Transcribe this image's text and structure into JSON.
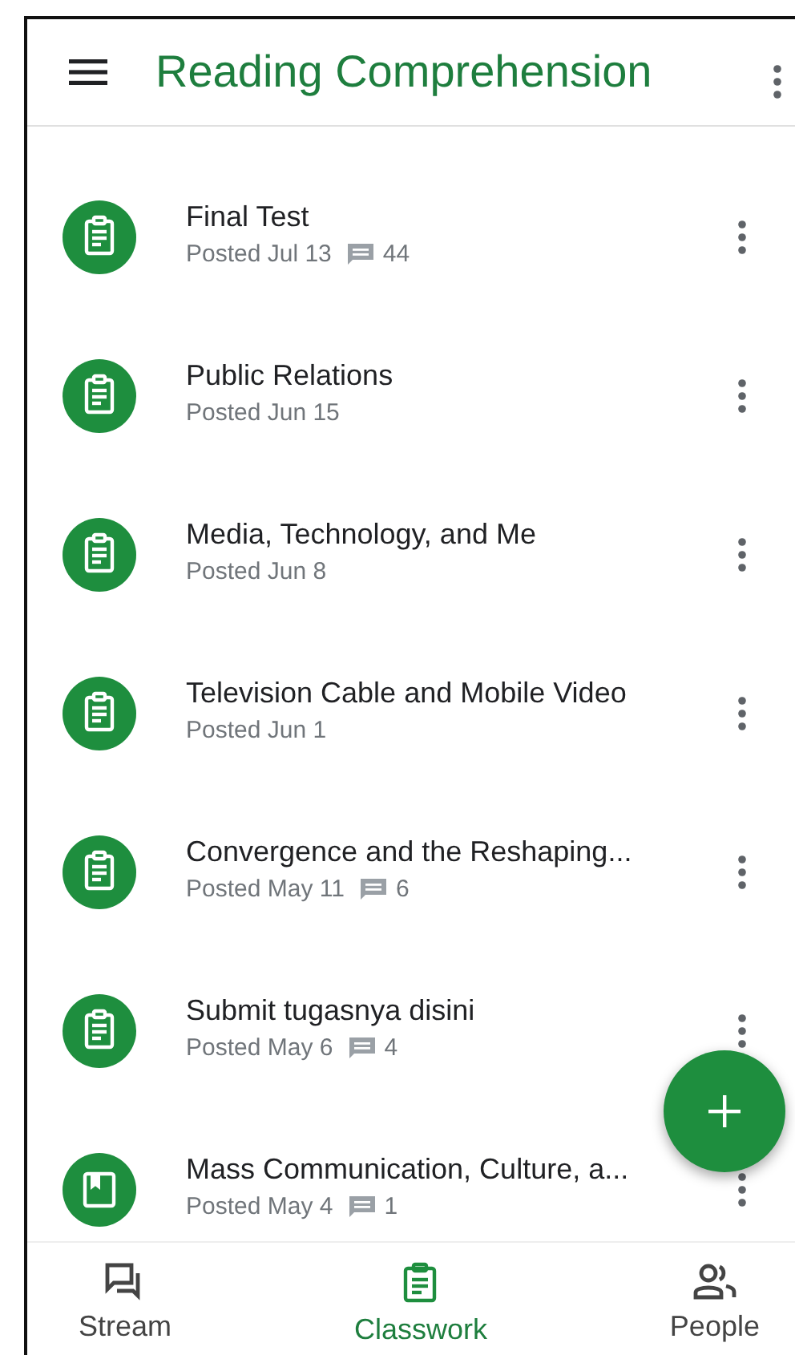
{
  "app_bar": {
    "title": "Reading Comprehension"
  },
  "items": [
    {
      "kind": "assignment",
      "title": "Final Test",
      "posted": "Posted Jul 13",
      "comments": "44"
    },
    {
      "kind": "assignment",
      "title": "Public Relations",
      "posted": "Posted Jun 15"
    },
    {
      "kind": "assignment",
      "title": "Media, Technology, and Me",
      "posted": "Posted Jun 8"
    },
    {
      "kind": "assignment",
      "title": "Television Cable and Mobile Video",
      "posted": "Posted Jun 1"
    },
    {
      "kind": "assignment",
      "title": "Convergence and the Reshaping...",
      "posted": "Posted May 11",
      "comments": "6"
    },
    {
      "kind": "assignment",
      "title": "Submit tugasnya disini",
      "posted": "Posted May 6",
      "comments": "4"
    },
    {
      "kind": "material",
      "title": "Mass Communication, Culture, a...",
      "posted": "Posted May 4",
      "comments": "1"
    }
  ],
  "bottom_nav": [
    {
      "kind": "stream",
      "label": "Stream",
      "selected": false
    },
    {
      "kind": "classwork",
      "label": "Classwork",
      "selected": true
    },
    {
      "kind": "people",
      "label": "People",
      "selected": false
    }
  ]
}
